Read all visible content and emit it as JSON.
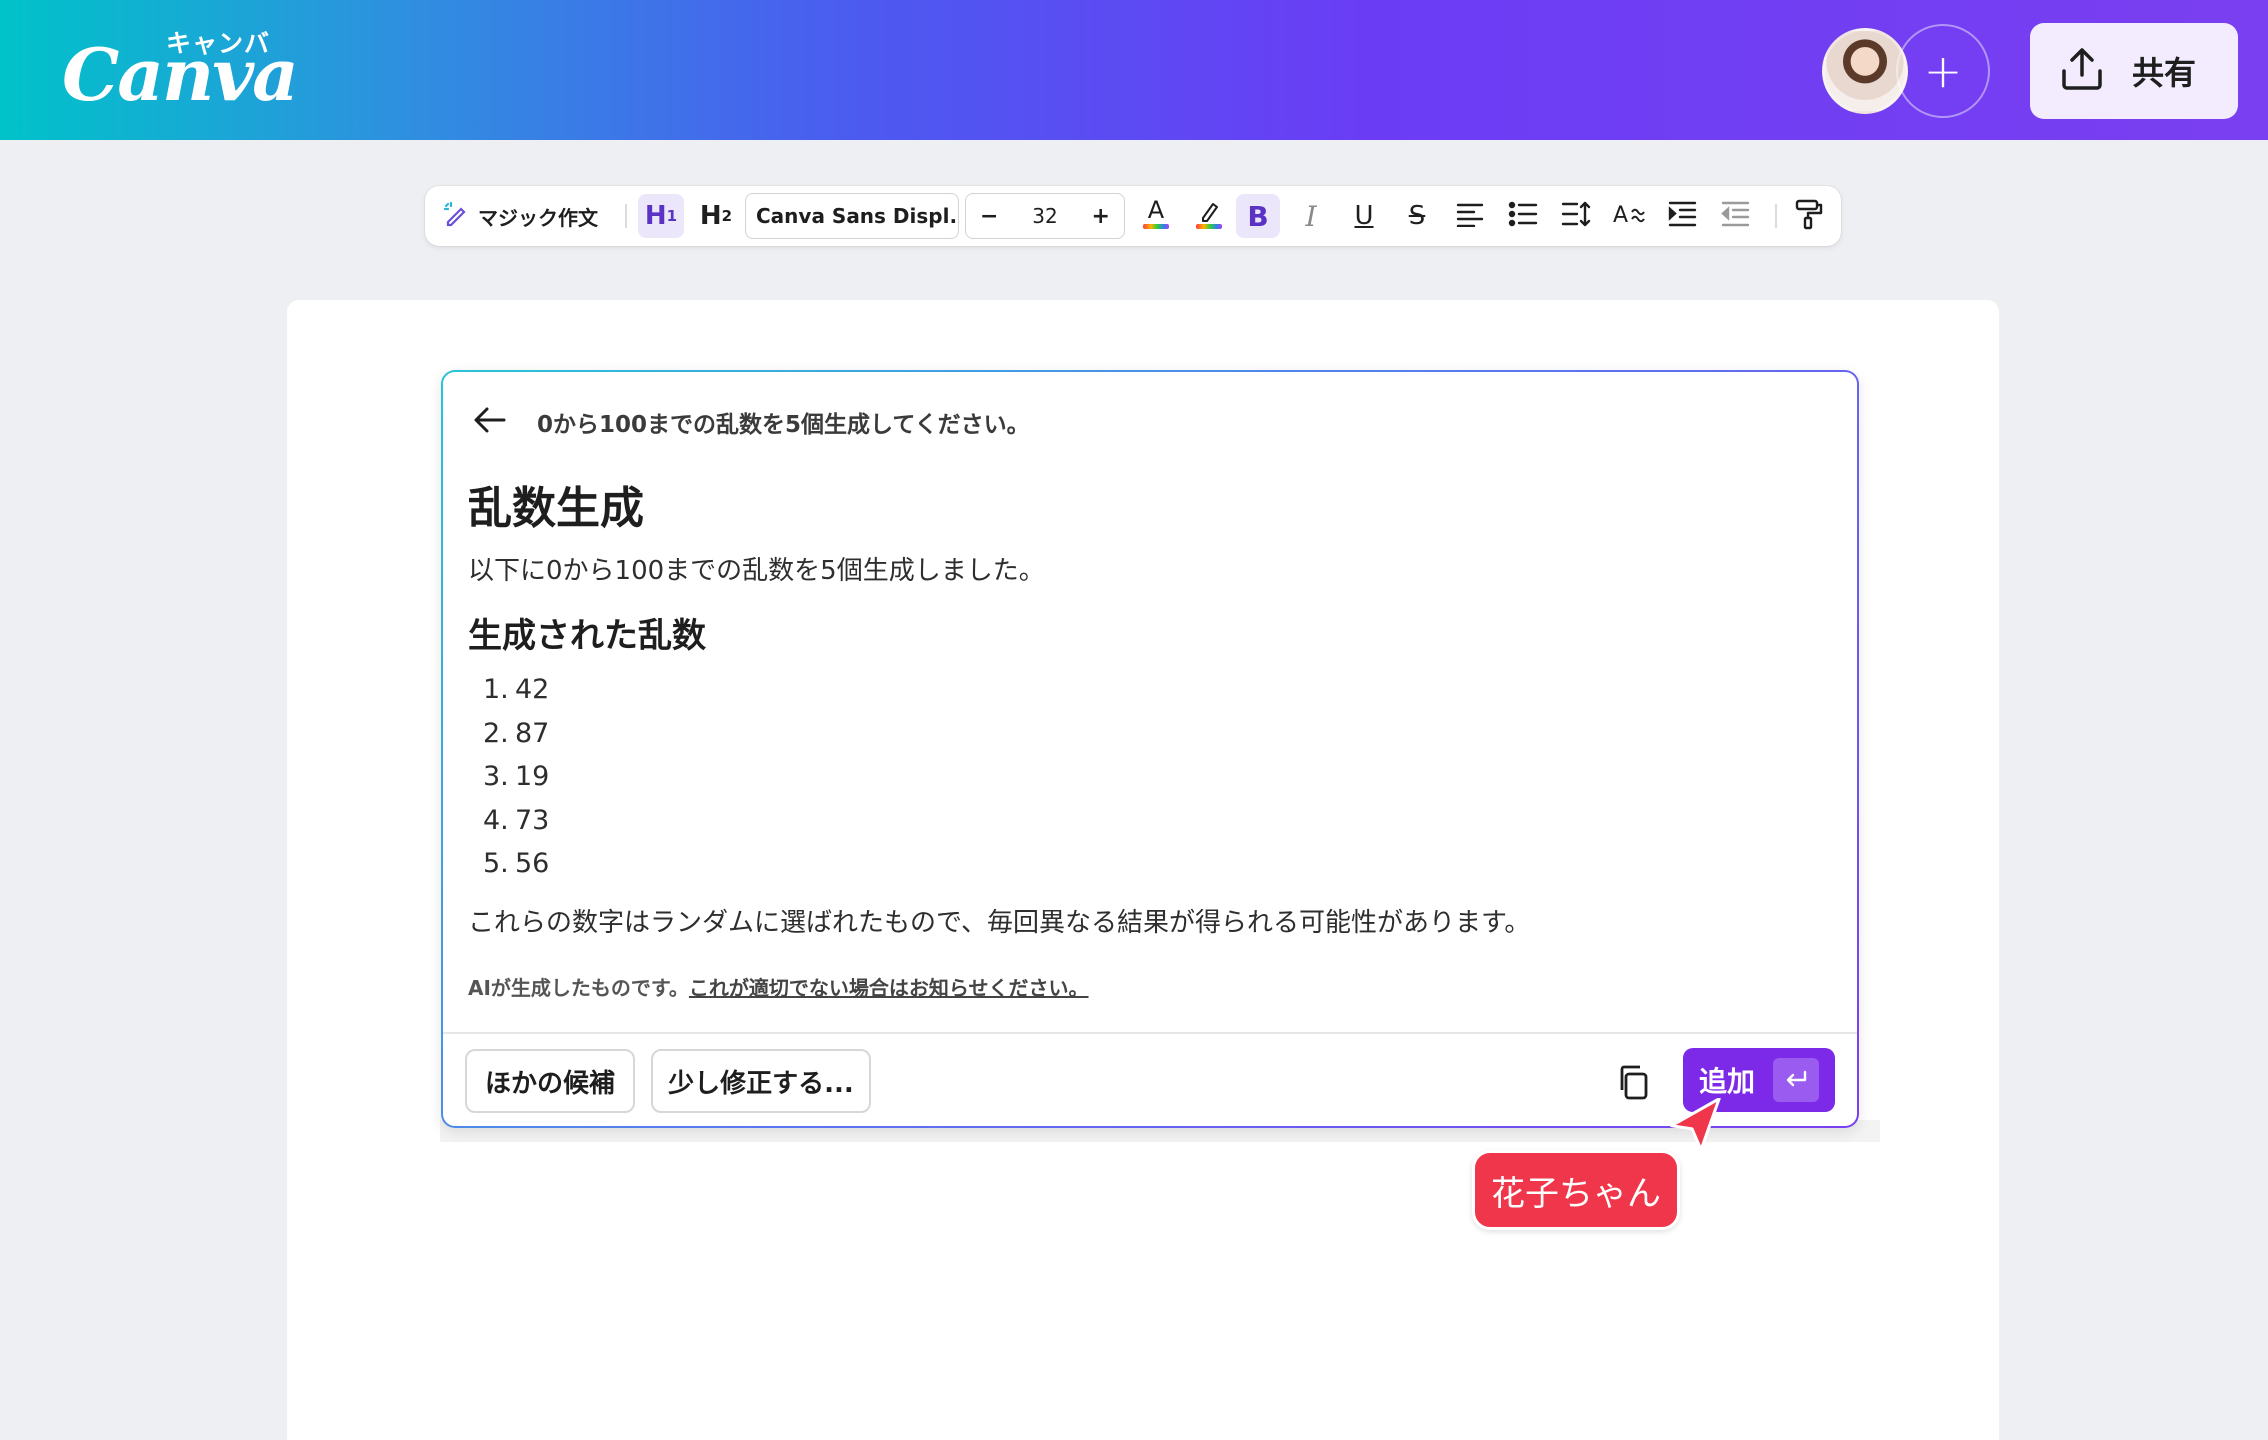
{
  "header": {
    "logo_text": "Canva",
    "logo_kana": "キャンバ",
    "share_label": "共有"
  },
  "toolbar": {
    "magic_write": "マジック作文",
    "h1": "H",
    "h1_sub": "1",
    "h2": "H",
    "h2_sub": "2",
    "font_name": "Canva Sans Displ...",
    "font_size": "32",
    "minus": "−",
    "plus": "+",
    "bold": "B",
    "italic": "I",
    "underline": "U",
    "strikethrough": "S"
  },
  "card": {
    "prompt": "0から100までの乱数を5個生成してください。",
    "heading": "乱数生成",
    "intro": "以下に0から100までの乱数を5個生成しました。",
    "subheading": "生成された乱数",
    "list": [
      {
        "num": "1.",
        "value": "42"
      },
      {
        "num": "2.",
        "value": "87"
      },
      {
        "num": "3.",
        "value": "19"
      },
      {
        "num": "4.",
        "value": "73"
      },
      {
        "num": "5.",
        "value": "56"
      }
    ],
    "note": "これらの数字はランダムに選ばれたもので、毎回異なる結果が得られる可能性があります。",
    "disclaimer": "AIが生成したものです。",
    "report_link": "これが適切でない場合はお知らせください。",
    "btn_other": "ほかの候補",
    "btn_modify": "少し修正する...",
    "btn_add": "追加"
  },
  "collaborator": {
    "name": "花子ちゃん"
  },
  "colors": {
    "brand_purple": "#7d2ae8",
    "collab_red": "#f0364a"
  }
}
